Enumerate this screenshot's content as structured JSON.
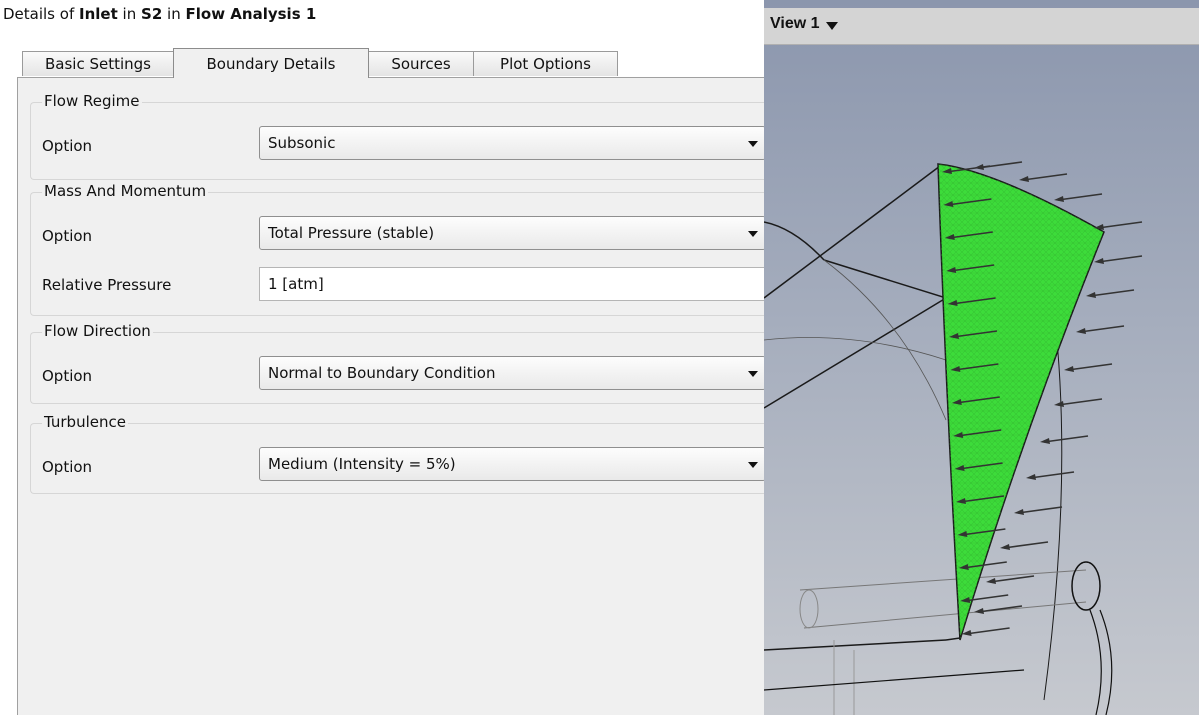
{
  "details": {
    "prefix": "Details of",
    "object": "Inlet",
    "in_1": "in",
    "domain": "S2",
    "in_2": "in",
    "analysis": "Flow Analysis 1"
  },
  "tabs": [
    {
      "label": "Basic Settings",
      "active": false
    },
    {
      "label": "Boundary Details",
      "active": true
    },
    {
      "label": "Sources",
      "active": false
    },
    {
      "label": "Plot Options",
      "active": false
    }
  ],
  "flow_regime": {
    "title": "Flow Regime",
    "option_label": "Option",
    "option_value": "Subsonic"
  },
  "mass_momentum": {
    "title": "Mass And Momentum",
    "option_label": "Option",
    "option_value": "Total Pressure (stable)",
    "relative_pressure_label": "Relative Pressure",
    "relative_pressure_value": "1 [atm]"
  },
  "flow_direction": {
    "title": "Flow Direction",
    "option_label": "Option",
    "option_value": "Normal to Boundary Condition"
  },
  "turbulence": {
    "title": "Turbulence",
    "option_label": "Option",
    "option_value": "Medium (Intensity = 5%)"
  },
  "viewport": {
    "label": "View 1",
    "dropdown_icon": "triangle-down-icon",
    "inlet_color": "#3ddc3a",
    "arrow_color": "#333333"
  }
}
